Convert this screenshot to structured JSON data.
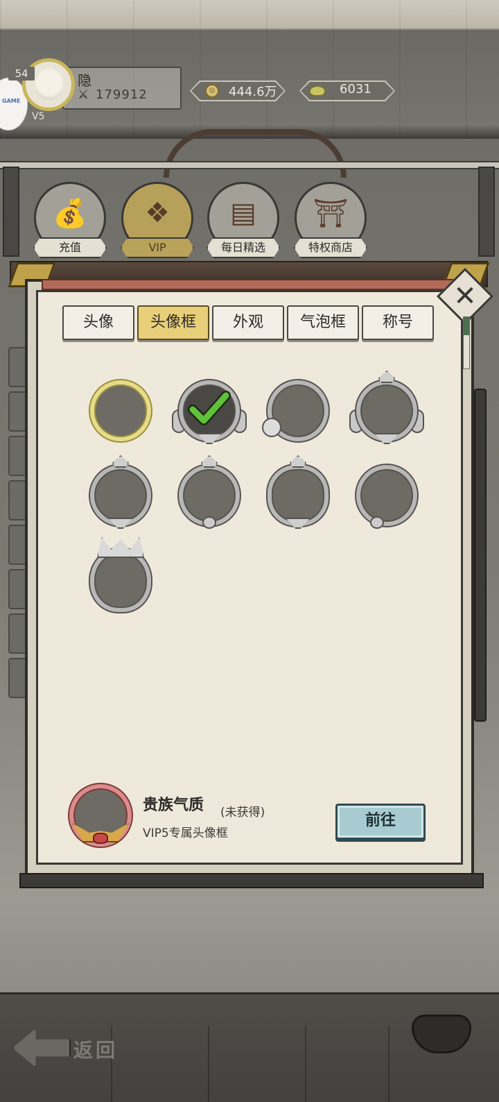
{
  "player": {
    "level": "54",
    "name": "隐",
    "power": "179912",
    "vip_label": "V5",
    "side_badge": "GAME"
  },
  "currencies": [
    {
      "icon": "coin-icon",
      "value": "444.6万"
    },
    {
      "icon": "ingot-icon",
      "value": "6031"
    }
  ],
  "shop_tabs": [
    {
      "label": "充值",
      "icon": "money-bag-icon",
      "active": false
    },
    {
      "label": "VIP",
      "icon": "vip-emblem-icon",
      "active": true
    },
    {
      "label": "每日精选",
      "icon": "treasure-chest-icon",
      "active": false
    },
    {
      "label": "特权商店",
      "icon": "shop-gate-icon",
      "active": false
    }
  ],
  "panel_tabs": [
    {
      "label": "头像",
      "active": false
    },
    {
      "label": "头像框",
      "active": true
    },
    {
      "label": "外观",
      "active": false
    },
    {
      "label": "气泡框",
      "active": false
    },
    {
      "label": "称号",
      "active": false
    }
  ],
  "frames": [
    {
      "style": "gold-ring",
      "selected": false
    },
    {
      "style": "ornate-wings",
      "selected": true
    },
    {
      "style": "knot",
      "selected": false
    },
    {
      "style": "crown-wings",
      "selected": false
    },
    {
      "style": "crest-base",
      "selected": false
    },
    {
      "style": "star-pearl",
      "selected": false
    },
    {
      "style": "lotus",
      "selected": false
    },
    {
      "style": "pearl",
      "selected": false
    },
    {
      "style": "dragon-heart",
      "selected": false
    }
  ],
  "detail": {
    "name": "贵族气质",
    "status": "(未获得)",
    "description": "VIP5专属头像框",
    "button_label": "前往"
  },
  "footer": {
    "back_label": "返回"
  },
  "colors": {
    "panel_bg": "#efe9dc",
    "active_tab": "#e8cf7a",
    "go_button": "#a7cbd0",
    "check_green": "#5fc23a"
  }
}
